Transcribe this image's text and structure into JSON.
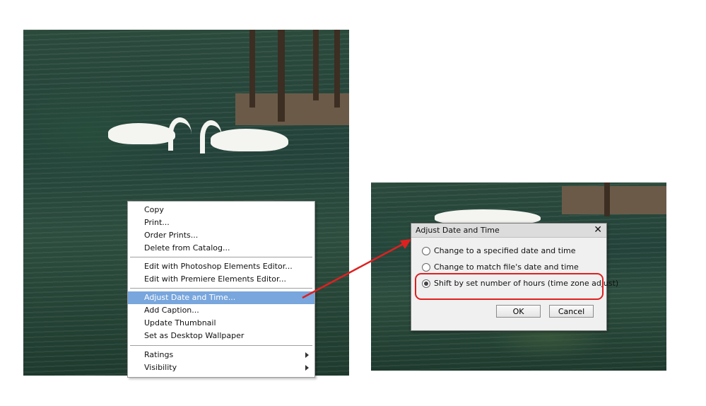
{
  "context_menu": {
    "items": [
      {
        "label": "Copy"
      },
      {
        "label": "Print..."
      },
      {
        "label": "Order Prints..."
      },
      {
        "label": "Delete from Catalog..."
      },
      {
        "label": "Edit with Photoshop Elements Editor..."
      },
      {
        "label": "Edit with Premiere Elements Editor..."
      },
      {
        "label": "Adjust Date and Time...",
        "selected": true
      },
      {
        "label": "Add Caption..."
      },
      {
        "label": "Update Thumbnail"
      },
      {
        "label": "Set as Desktop Wallpaper"
      },
      {
        "label": "Ratings",
        "submenu": true
      },
      {
        "label": "Visibility",
        "submenu": true
      }
    ],
    "selected_color": "#78a6dd"
  },
  "dialog": {
    "title": "Adjust Date and Time",
    "options": [
      {
        "label": "Change to a specified date and time",
        "checked": false
      },
      {
        "label": "Change to match file's date and time",
        "checked": false
      },
      {
        "label": "Shift by set number of hours (time zone adjust)",
        "checked": true
      }
    ],
    "ok_label": "OK",
    "cancel_label": "Cancel"
  },
  "annotation": {
    "color": "#e02020",
    "icon": "arrow-icon"
  }
}
